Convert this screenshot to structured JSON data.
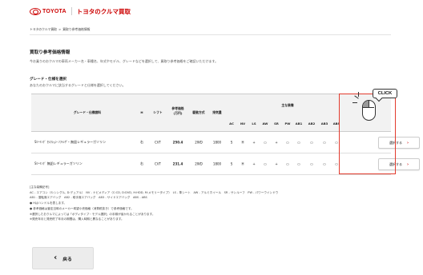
{
  "header": {
    "logo_text": "TOYOTA",
    "brand": "トヨタのクルマ買取"
  },
  "breadcrumb": {
    "items": [
      "トヨタのクルマ買取",
      ">",
      "買取り参考価格情報"
    ]
  },
  "page": {
    "title": "買取り参考価格情報",
    "intro": "今お乗りのおクルマの車両メーカー名・車種名、年式やモデル、グレードなどを選択して、買取り参考価格をご確認いただけます。",
    "sub_title": "グレード・仕様を選択",
    "sub_desc": "あなたのおクルマに該当するグレードと仕様を選択してください。"
  },
  "table": {
    "headers": {
      "grade": "グレード・仕様諸料",
      "h": "H",
      "shift": "シフト",
      "price": "参考価格\n(万円)",
      "drive": "駆動方式",
      "displacement": "排気量",
      "equipment": "主な装備",
      "equipment_cols": [
        "AC",
        "NV",
        "LS",
        "AW",
        "SR",
        "PW",
        "AB1",
        "AB2",
        "AB3",
        "ABS"
      ]
    },
    "rows": [
      {
        "grade": "Sﾂｰﾘﾝｸﾞ ｾﾚｸｼｮﾝ･ｿﾌﾄﾚｻﾞｰ 無鉛レギュラーガソリン",
        "h": "右",
        "shift": "CVT",
        "price": "250.4",
        "drive": "2WD",
        "displacement": "1800",
        "equipment": [
          "S",
          "H",
          "+",
          "○",
          "+",
          "○",
          "○",
          "○",
          "○",
          "○"
        ],
        "select_label": "選択する"
      },
      {
        "grade": "Sﾂｰﾘﾝｸﾞ 無鉛レギュラーガソリン",
        "h": "右",
        "shift": "CVT",
        "price": "231.4",
        "drive": "2WD",
        "displacement": "1800",
        "equipment": [
          "S",
          "H",
          "+",
          "○",
          "+",
          "○",
          "○",
          "○",
          "○",
          "○"
        ],
        "select_label": "選択する"
      }
    ]
  },
  "callout": {
    "label": "CLICK",
    "icon": "mouse-icon",
    "border_color": "#e23b2e"
  },
  "notes": {
    "lines": [
      "[主な装備記号]",
      "AC - エアコン（S:シングル, D:デュアル）　NV - ナビメディア（C:CD, D:DVD, H:HDD, M:メモリータイプ）　LS - 革シート　AW - アルミホイール　SR - サンルーフ　PW - パワーウインドウ",
      "AB1 - 運転席エアバッグ　AB2 - 助手席エアバッグ　AB3 - サイドエアバッグ　ABS - ABS",
      "● Hはハンドルを表します。",
      "● 参考価格は査定当時のメーカー希望小売価格（消費税抜き）で参考価格です。",
      "",
      "※選択したおクルマによっては「ボディタイプ・モデル選択」の手順が省かれることがあります。",
      "※発売年月と発売終了年月の期間は、購入時期と異なることがあります。"
    ]
  },
  "footer": {
    "back_label": "戻る"
  },
  "colors": {
    "brand_red": "#cc0000",
    "callout_red": "#e23b2e"
  }
}
